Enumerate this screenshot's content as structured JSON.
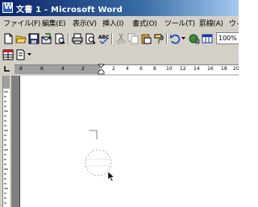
{
  "window": {
    "title": "文書 1 - Microsoft Word"
  },
  "menu": {
    "items": [
      {
        "label": "ファイル(F)"
      },
      {
        "label": "編集(E)"
      },
      {
        "label": "表示(V)"
      },
      {
        "label": "挿入(I)"
      },
      {
        "label": "書式(O)"
      },
      {
        "label": "ツール(T)"
      },
      {
        "label": "罫線(A)"
      },
      {
        "label": "ウィ"
      }
    ]
  },
  "toolbar": {
    "zoom": "100%",
    "icons": [
      "new-document-icon",
      "open-folder-icon",
      "save-icon",
      "email-icon",
      "print-preview-icon",
      "print-icon",
      "spell-check-icon",
      "cut-icon",
      "copy-icon",
      "paste-icon",
      "format-painter-icon",
      "undo-icon",
      "insert-hyperlink-icon",
      "tables-borders-icon"
    ]
  },
  "ruler": {
    "labels": [
      "8",
      "6",
      "4",
      "2",
      "2",
      "4",
      "6",
      "8",
      "10",
      "12",
      "14",
      "16",
      "18",
      "20"
    ]
  },
  "document": {
    "shapes": [
      "corner-mark",
      "dashed-circle-shape",
      "mouse-cursor-icon"
    ]
  }
}
